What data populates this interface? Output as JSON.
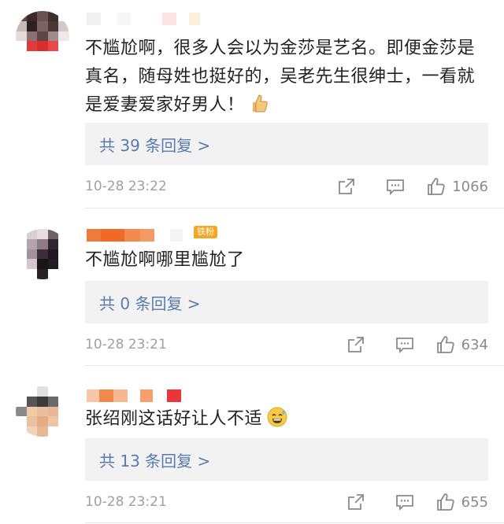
{
  "comments": [
    {
      "text": "不尴尬啊，很多人会以为金莎是艺名。即便金莎是真名，随母姓也挺好的，吴老先生很绅士，一看就是爱妻爱家好男人！",
      "emoji": "thumbs-up",
      "reply_label": "共 39 条回复 >",
      "time": "10-28 23:22",
      "likes": "1066"
    },
    {
      "text": "不尴尬啊哪里尴尬了",
      "badge": "铁粉",
      "reply_label": "共 0 条回复 >",
      "time": "10-28 23:21",
      "likes": "634"
    },
    {
      "text": "张绍刚这话好让人不适",
      "emoji": "sweat-smile",
      "reply_label": "共 13 条回复 >",
      "time": "10-28 23:21",
      "likes": "655"
    }
  ],
  "icons": [
    "share-icon",
    "comment-icon",
    "like-icon"
  ],
  "colors": {
    "reply_link": "#5a7bb0",
    "reply_bg": "#f2f2f2",
    "meta_gray": "#a0a0a0",
    "badge_orange": "#f5a623"
  }
}
